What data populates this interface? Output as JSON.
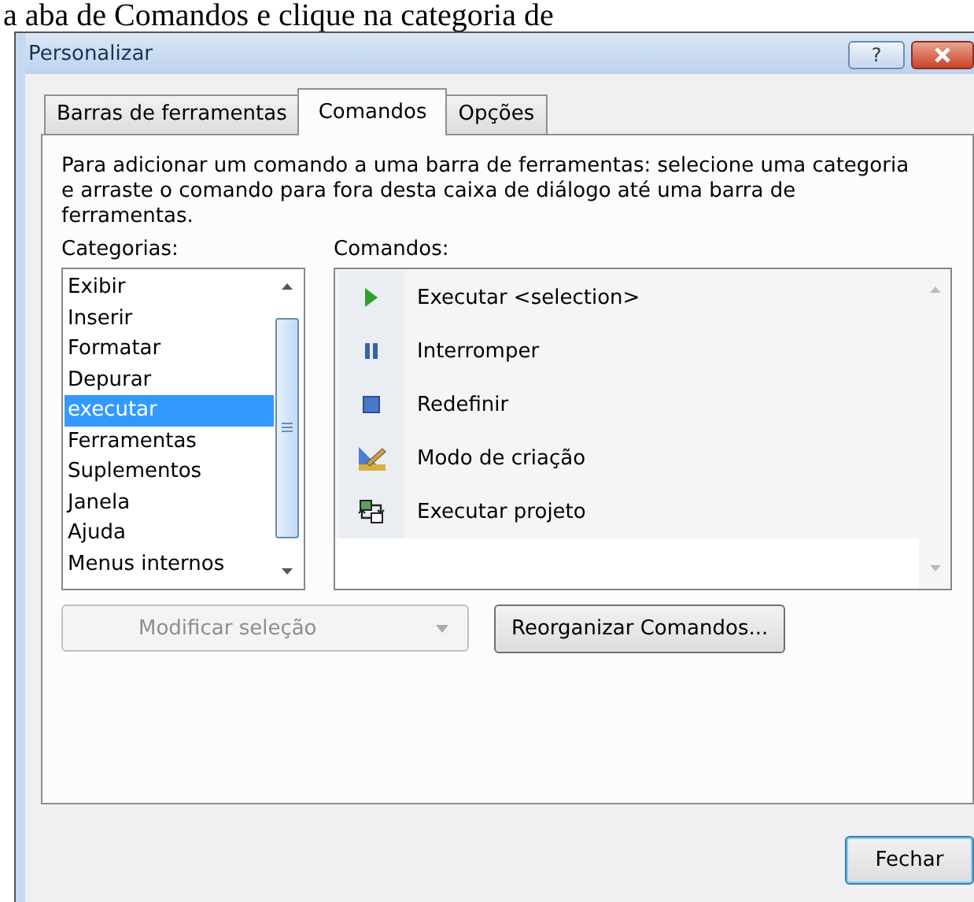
{
  "background_text": "a aba de Comandos e clique na categoria de",
  "window": {
    "title": "Personalizar",
    "title_buttons": [
      {
        "kind": "help",
        "label": "?"
      },
      {
        "kind": "close"
      }
    ]
  },
  "tabs": [
    {
      "label": "Barras de ferramentas",
      "selected": false
    },
    {
      "label": "Comandos",
      "selected": true
    },
    {
      "label": "Opções",
      "selected": false
    }
  ],
  "instructions": "Para adicionar um comando a uma barra de ferramentas: selecione uma categoria e arraste o comando para fora desta caixa de diálogo até uma barra de ferramentas.",
  "categories": {
    "label": "Categorias:",
    "items": [
      {
        "label": "Exibir",
        "selected": false
      },
      {
        "label": "Inserir",
        "selected": false
      },
      {
        "label": "Formatar",
        "selected": false
      },
      {
        "label": "Depurar",
        "selected": false
      },
      {
        "label": "executar",
        "selected": true
      },
      {
        "label": "Ferramentas",
        "selected": false
      },
      {
        "label": "Suplementos",
        "selected": false
      },
      {
        "label": "Janela",
        "selected": false
      },
      {
        "label": "Ajuda",
        "selected": false
      },
      {
        "label": "Menus internos",
        "selected": false
      }
    ]
  },
  "commands": {
    "label": "Comandos:",
    "items": [
      {
        "kind": "run",
        "label": "Executar <selection>"
      },
      {
        "kind": "pause",
        "label": "Interromper"
      },
      {
        "kind": "stop",
        "label": "Redefinir"
      },
      {
        "kind": "design",
        "label": "Modo de criação"
      },
      {
        "kind": "project",
        "label": "Executar projeto"
      }
    ]
  },
  "modify_selection": {
    "label": "Modificar seleção",
    "disabled": true
  },
  "rearrange_button": "Reorganizar Comandos...",
  "close_button": "Fechar"
}
